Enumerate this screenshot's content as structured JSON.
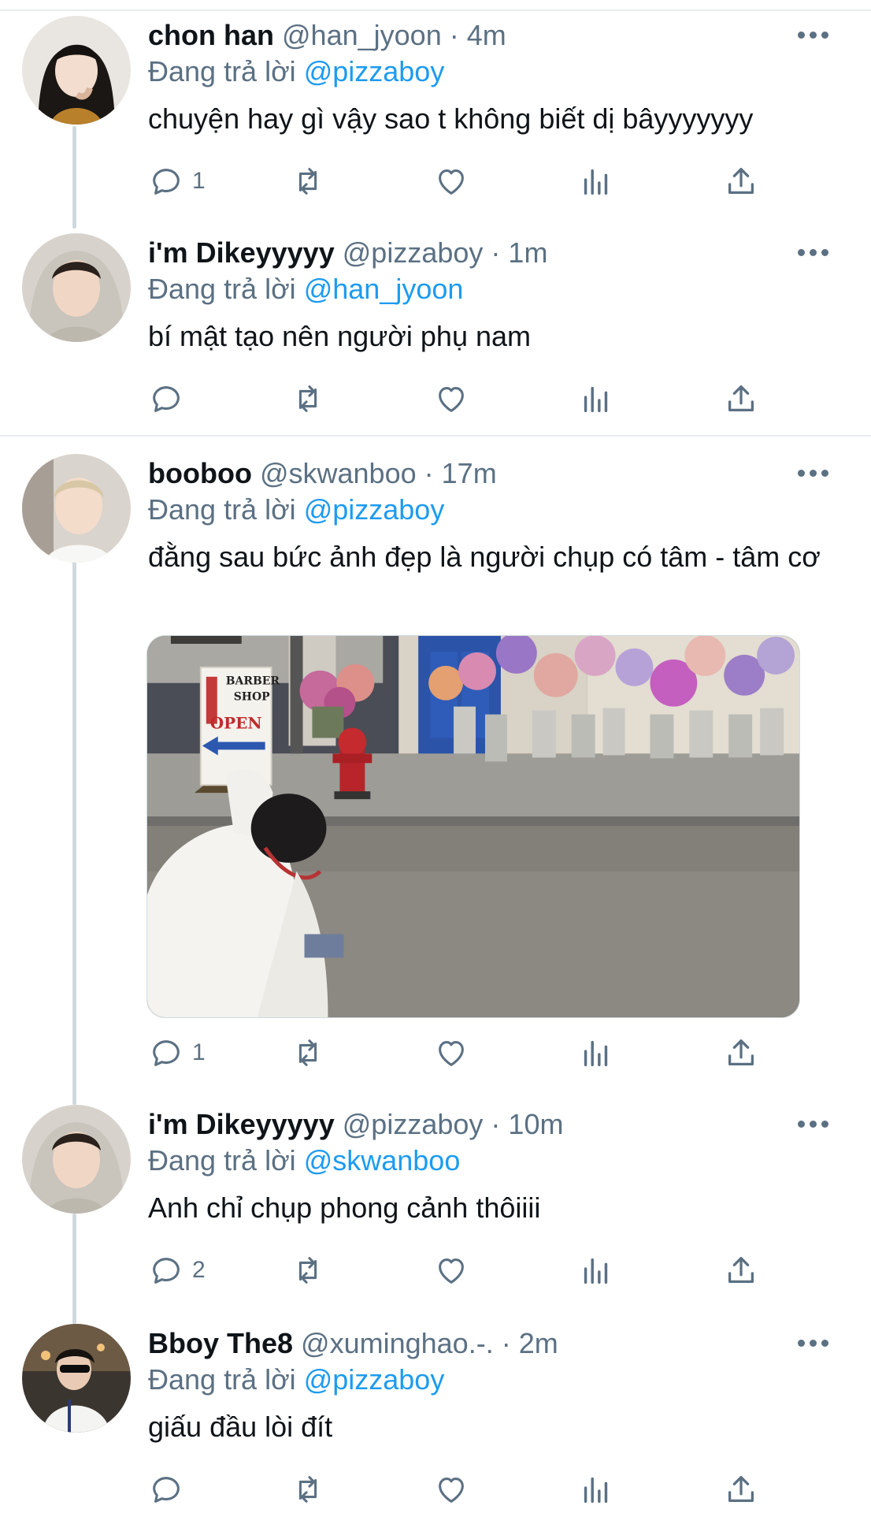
{
  "reply_prefix": "Đang trả lời",
  "tweets": [
    {
      "name": "chon han",
      "handle": "@han_jyoon",
      "time": "4m",
      "reply_to": "@pizzaboy",
      "text": "chuyện hay gì vậy sao t không biết dị bâyyyyyyy",
      "reply_count": "1"
    },
    {
      "name": "i'm Dikeyyyyy",
      "handle": "@pizzaboy",
      "time": "1m",
      "reply_to": "@han_jyoon",
      "text": "bí mật tạo nên người phụ nam",
      "reply_count": ""
    },
    {
      "name": "booboo",
      "handle": "@skwanboo",
      "time": "17m",
      "reply_to": "@pizzaboy",
      "text": "đằng sau bức ảnh đẹp là người chụp có tâm - tâm cơ",
      "reply_count": "1",
      "media": {
        "sign_lines": [
          "BARBER",
          "SHOP",
          "OPEN"
        ]
      }
    },
    {
      "name": "i'm Dikeyyyyy",
      "handle": "@pizzaboy",
      "time": "10m",
      "reply_to": "@skwanboo",
      "text": "Anh chỉ chụp phong cảnh thôiiii",
      "reply_count": "2"
    },
    {
      "name": "Bboy The8",
      "handle": "@xuminghao.-.",
      "time": "2m",
      "reply_to": "@pizzaboy",
      "text": "giấu đầu lòi đít",
      "reply_count": ""
    }
  ],
  "colors": {
    "link": "#1d9bf0",
    "secondary": "#5b7083",
    "text": "#0f1419",
    "thread_line": "#cfd9de"
  },
  "icons": [
    "reply-icon",
    "retweet-icon",
    "like-icon",
    "analytics-icon",
    "share-icon",
    "more-icon"
  ]
}
